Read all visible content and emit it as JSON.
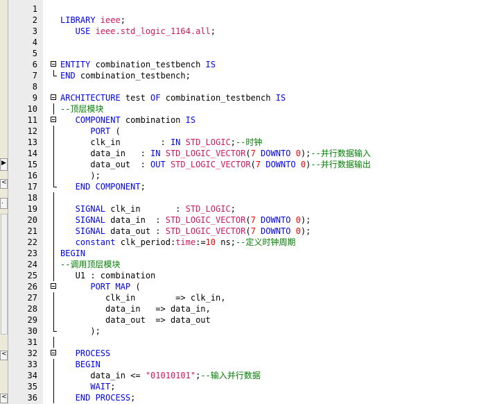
{
  "editor": {
    "lines": [
      {
        "n": "1",
        "fold": "",
        "segs": []
      },
      {
        "n": "2",
        "fold": "",
        "segs": [
          {
            "t": "LIBRARY ",
            "c": "kw"
          },
          {
            "t": "ieee",
            "c": "ty"
          },
          {
            "t": ";",
            "c": "tx"
          }
        ]
      },
      {
        "n": "3",
        "fold": "",
        "segs": [
          {
            "t": "   USE ",
            "c": "kw"
          },
          {
            "t": "ieee.std_logic_1164.all",
            "c": "ty"
          },
          {
            "t": ";",
            "c": "tx"
          }
        ]
      },
      {
        "n": "4",
        "fold": "",
        "segs": []
      },
      {
        "n": "5",
        "fold": "",
        "segs": []
      },
      {
        "n": "6",
        "fold": "box",
        "segs": [
          {
            "t": "ENTITY ",
            "c": "kw"
          },
          {
            "t": "combination_testbench ",
            "c": "tx"
          },
          {
            "t": "IS",
            "c": "kw"
          }
        ]
      },
      {
        "n": "7",
        "fold": "end",
        "segs": [
          {
            "t": "END ",
            "c": "kw"
          },
          {
            "t": "combination_testbench;",
            "c": "tx"
          }
        ]
      },
      {
        "n": "8",
        "fold": "",
        "segs": []
      },
      {
        "n": "9",
        "fold": "box",
        "segs": [
          {
            "t": "ARCHITECTURE ",
            "c": "kw"
          },
          {
            "t": "test ",
            "c": "tx"
          },
          {
            "t": "OF ",
            "c": "kw"
          },
          {
            "t": "combination_testbench ",
            "c": "tx"
          },
          {
            "t": "IS",
            "c": "kw"
          }
        ]
      },
      {
        "n": "10",
        "fold": "line",
        "segs": [
          {
            "t": "--顶层模块",
            "c": "cm"
          }
        ]
      },
      {
        "n": "11",
        "fold": "box",
        "segs": [
          {
            "t": "   COMPONENT ",
            "c": "kw"
          },
          {
            "t": "combination ",
            "c": "tx"
          },
          {
            "t": "IS",
            "c": "kw"
          }
        ]
      },
      {
        "n": "12",
        "fold": "line",
        "segs": [
          {
            "t": "      PORT ",
            "c": "kw"
          },
          {
            "t": "(",
            "c": "tx"
          }
        ]
      },
      {
        "n": "13",
        "fold": "line",
        "segs": [
          {
            "t": "      clk_in        : ",
            "c": "tx"
          },
          {
            "t": "IN ",
            "c": "kw"
          },
          {
            "t": "STD_LOGIC",
            "c": "ty"
          },
          {
            "t": ";",
            "c": "tx"
          },
          {
            "t": "--时钟",
            "c": "cm"
          }
        ]
      },
      {
        "n": "14",
        "fold": "line",
        "segs": [
          {
            "t": "      data_in   : ",
            "c": "tx"
          },
          {
            "t": "IN ",
            "c": "kw"
          },
          {
            "t": "STD_LOGIC_VECTOR",
            "c": "ty"
          },
          {
            "t": "(",
            "c": "tx"
          },
          {
            "t": "7 ",
            "c": "nm"
          },
          {
            "t": "DOWNTO ",
            "c": "kw"
          },
          {
            "t": "0",
            "c": "nm"
          },
          {
            "t": ");",
            "c": "tx"
          },
          {
            "t": "--并行数据输入",
            "c": "cm"
          }
        ]
      },
      {
        "n": "15",
        "fold": "line",
        "segs": [
          {
            "t": "      data_out  : ",
            "c": "tx"
          },
          {
            "t": "OUT ",
            "c": "kw"
          },
          {
            "t": "STD_LOGIC_VECTOR",
            "c": "ty"
          },
          {
            "t": "(",
            "c": "tx"
          },
          {
            "t": "7 ",
            "c": "nm"
          },
          {
            "t": "DOWNTO ",
            "c": "kw"
          },
          {
            "t": "0",
            "c": "nm"
          },
          {
            "t": ")",
            "c": "tx"
          },
          {
            "t": "--并行数据输出",
            "c": "cm"
          }
        ]
      },
      {
        "n": "16",
        "fold": "line",
        "segs": [
          {
            "t": "      );",
            "c": "tx"
          }
        ]
      },
      {
        "n": "17",
        "fold": "end",
        "segs": [
          {
            "t": "   END COMPONENT",
            "c": "kw"
          },
          {
            "t": ";",
            "c": "tx"
          }
        ]
      },
      {
        "n": "18",
        "fold": "line",
        "segs": []
      },
      {
        "n": "19",
        "fold": "line",
        "segs": [
          {
            "t": "   SIGNAL ",
            "c": "kw"
          },
          {
            "t": "clk_in       : ",
            "c": "tx"
          },
          {
            "t": "STD_LOGIC",
            "c": "ty"
          },
          {
            "t": ";",
            "c": "tx"
          }
        ]
      },
      {
        "n": "20",
        "fold": "line",
        "segs": [
          {
            "t": "   SIGNAL ",
            "c": "kw"
          },
          {
            "t": "data_in  : ",
            "c": "tx"
          },
          {
            "t": "STD_LOGIC_VECTOR",
            "c": "ty"
          },
          {
            "t": "(",
            "c": "tx"
          },
          {
            "t": "7 ",
            "c": "nm"
          },
          {
            "t": "DOWNTO ",
            "c": "kw"
          },
          {
            "t": "0",
            "c": "nm"
          },
          {
            "t": ");",
            "c": "tx"
          }
        ]
      },
      {
        "n": "21",
        "fold": "line",
        "segs": [
          {
            "t": "   SIGNAL ",
            "c": "kw"
          },
          {
            "t": "data_out : ",
            "c": "tx"
          },
          {
            "t": "STD_LOGIC_VECTOR",
            "c": "ty"
          },
          {
            "t": "(",
            "c": "tx"
          },
          {
            "t": "7 ",
            "c": "nm"
          },
          {
            "t": "DOWNTO ",
            "c": "kw"
          },
          {
            "t": "0",
            "c": "nm"
          },
          {
            "t": ");",
            "c": "tx"
          }
        ]
      },
      {
        "n": "22",
        "fold": "line",
        "segs": [
          {
            "t": "   constant ",
            "c": "kw"
          },
          {
            "t": "clk_period:",
            "c": "tx"
          },
          {
            "t": "time",
            "c": "ty"
          },
          {
            "t": ":=",
            "c": "tx"
          },
          {
            "t": "10 ",
            "c": "nm"
          },
          {
            "t": "ns;",
            "c": "tx"
          },
          {
            "t": "--定义时钟周期",
            "c": "cm"
          }
        ]
      },
      {
        "n": "23",
        "fold": "line",
        "segs": [
          {
            "t": "BEGIN",
            "c": "kw"
          }
        ]
      },
      {
        "n": "24",
        "fold": "line",
        "segs": [
          {
            "t": "--调用顶层模块",
            "c": "cm"
          }
        ]
      },
      {
        "n": "25",
        "fold": "line",
        "segs": [
          {
            "t": "   U1 : combination",
            "c": "tx"
          }
        ]
      },
      {
        "n": "26",
        "fold": "box",
        "segs": [
          {
            "t": "      PORT MAP ",
            "c": "kw"
          },
          {
            "t": "(",
            "c": "tx"
          }
        ]
      },
      {
        "n": "27",
        "fold": "line",
        "segs": [
          {
            "t": "         clk_in        => clk_in,",
            "c": "tx"
          }
        ]
      },
      {
        "n": "28",
        "fold": "line",
        "segs": [
          {
            "t": "         data_in   => data_in,",
            "c": "tx"
          }
        ]
      },
      {
        "n": "29",
        "fold": "line",
        "segs": [
          {
            "t": "         data_out  => data_out",
            "c": "tx"
          }
        ]
      },
      {
        "n": "30",
        "fold": "end",
        "segs": [
          {
            "t": "      );",
            "c": "tx"
          }
        ]
      },
      {
        "n": "31",
        "fold": "line",
        "segs": []
      },
      {
        "n": "32",
        "fold": "box",
        "segs": [
          {
            "t": "   PROCESS",
            "c": "kw"
          }
        ]
      },
      {
        "n": "33",
        "fold": "line",
        "segs": [
          {
            "t": "   BEGIN",
            "c": "kw"
          }
        ]
      },
      {
        "n": "34",
        "fold": "line",
        "segs": [
          {
            "t": "      data_in <= ",
            "c": "tx"
          },
          {
            "t": "\"01010101\"",
            "c": "st"
          },
          {
            "t": ";",
            "c": "tx"
          },
          {
            "t": "--输入并行数据",
            "c": "cm"
          }
        ]
      },
      {
        "n": "35",
        "fold": "line",
        "segs": [
          {
            "t": "      WAIT",
            "c": "kw"
          },
          {
            "t": ";",
            "c": "tx"
          }
        ]
      },
      {
        "n": "36",
        "fold": "line",
        "segs": [
          {
            "t": "   END PROCESS",
            "c": "kw"
          },
          {
            "t": ";",
            "c": "tx"
          }
        ]
      }
    ]
  },
  "leftbar": {
    "glyphs": [
      "▶",
      "<",
      ".",
      "<",
      "<"
    ]
  }
}
